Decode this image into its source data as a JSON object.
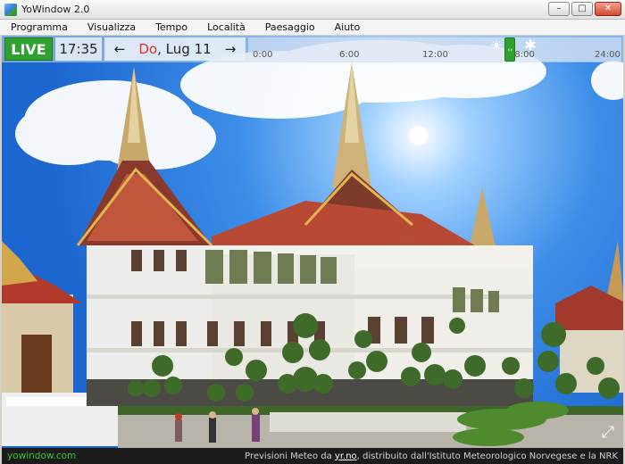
{
  "window": {
    "title": "YoWindow 2.0",
    "minimize_glyph": "–",
    "maximize_glyph": "□",
    "close_glyph": "✕"
  },
  "menu": [
    "Programma",
    "Visualizza",
    "Tempo",
    "Località",
    "Paesaggio",
    "Aiuto"
  ],
  "controls": {
    "live_label": "LIVE",
    "time": "17:35",
    "prev_arrow": "←",
    "next_arrow": "→",
    "date_day": "Do",
    "date_rest": ", Lug 11"
  },
  "timeline": {
    "labels": [
      "0:00",
      "6:00",
      "12:00",
      "18:00",
      "24:00"
    ],
    "slider_glyph": "‹›",
    "current_fraction": 0.73
  },
  "status": {
    "brand": "yowindow.com",
    "credit_prefix": "Previsioni Meteo da ",
    "credit_link": "yr.no",
    "credit_suffix": ", distribuito dall'Istituto Meteorologico Norvegese e la NRK"
  },
  "colors": {
    "live_green": "#2fa12f",
    "date_red": "#e23030",
    "brand_green": "#34c234"
  },
  "icons": {
    "sun": "☀",
    "snowflake": "✱",
    "fullscreen": "⤢"
  }
}
